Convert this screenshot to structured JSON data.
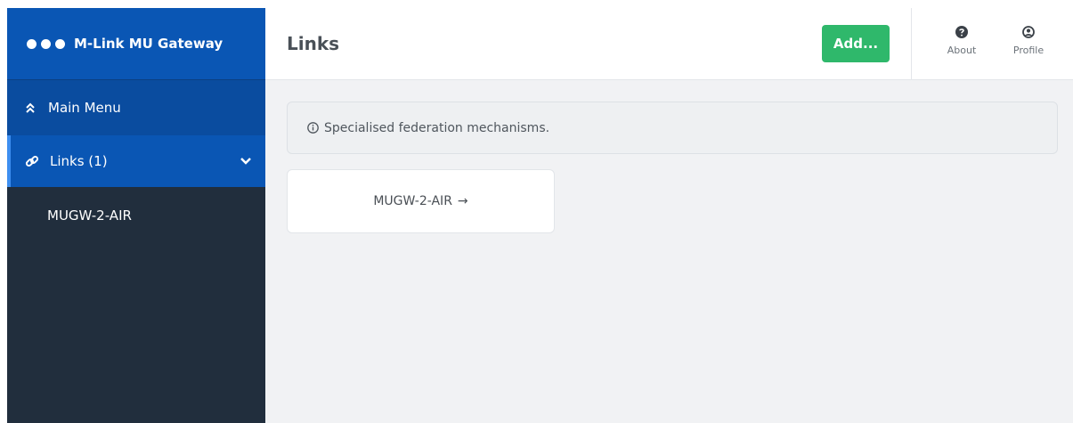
{
  "sidebar": {
    "brand": "M-Link MU Gateway",
    "main_menu": "Main Menu",
    "links_item": "Links (1)",
    "sub_items": [
      "MUGW-2-AIR"
    ]
  },
  "header": {
    "title": "Links",
    "add_label": "Add...",
    "about_label": "About",
    "profile_label": "Profile"
  },
  "main": {
    "info_text": "Specialised federation mechanisms.",
    "link_cards": [
      {
        "label": "MUGW-2-AIR",
        "arrow": "→"
      }
    ]
  },
  "colors": {
    "sidebar_bg": "#212e3d",
    "brand_bg": "#0a56b4",
    "active_bg": "#0a56b4",
    "add_button": "#2fb86b",
    "content_bg": "#f1f2f4"
  },
  "icons": {
    "brand": "three-dots-icon",
    "main_menu": "double-chevron-up-icon",
    "links": "link-icon",
    "links_toggle": "chevron-down-icon",
    "about": "question-circle-icon",
    "profile": "user-circle-icon",
    "info": "info-circle-icon"
  }
}
